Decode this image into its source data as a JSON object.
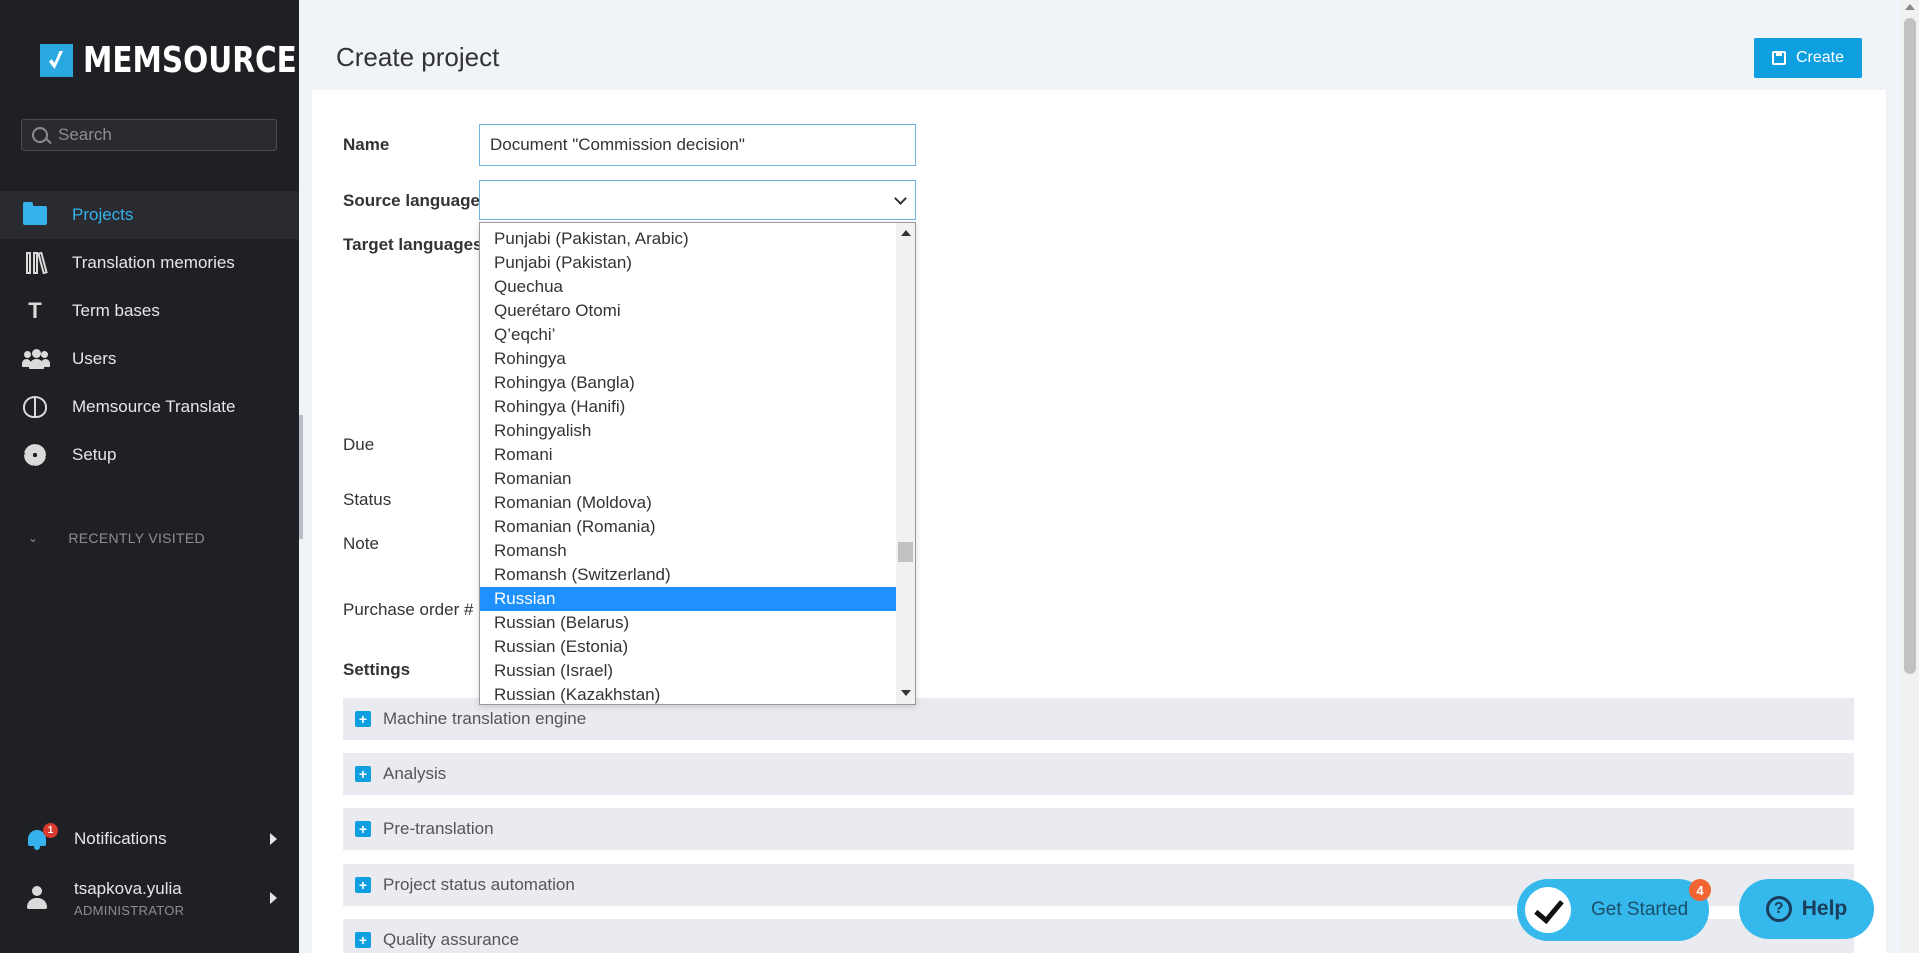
{
  "app": {
    "brand": "MEMSOURCE"
  },
  "sidebar": {
    "search_placeholder": "Search",
    "items": [
      {
        "label": "Projects",
        "icon": "folder-icon",
        "active": true
      },
      {
        "label": "Translation memories",
        "icon": "books-icon",
        "active": false
      },
      {
        "label": "Term bases",
        "icon": "text-icon",
        "active": false
      },
      {
        "label": "Users",
        "icon": "users-icon",
        "active": false
      },
      {
        "label": "Memsource Translate",
        "icon": "brain-icon",
        "active": false
      },
      {
        "label": "Setup",
        "icon": "gear-icon",
        "active": false
      }
    ],
    "term_bases_glyph": "T",
    "recently_visited": "RECENTLY VISITED",
    "notifications": {
      "label": "Notifications",
      "count": "1"
    },
    "user": {
      "name": "tsapkova.yulia",
      "role": "ADMINISTRATOR"
    }
  },
  "header": {
    "title": "Create project",
    "create_label": "Create"
  },
  "form": {
    "name_label": "Name",
    "name_value": "Document \"Commission decision\"",
    "source_label": "Source language",
    "source_value": "",
    "target_label": "Target languages",
    "due_label": "Due",
    "status_label": "Status",
    "note_label": "Note",
    "po_label": "Purchase order #"
  },
  "dropdown": {
    "options": [
      "Punjabi (Pakistan, Arabic)",
      "Punjabi (Pakistan)",
      "Quechua",
      "Querétaro Otomi",
      "Q’eqchi’",
      "Rohingya",
      "Rohingya (Bangla)",
      "Rohingya (Hanifi)",
      "Rohingyalish",
      "Romani",
      "Romanian",
      "Romanian (Moldova)",
      "Romanian (Romania)",
      "Romansh",
      "Romansh (Switzerland)",
      "Russian",
      "Russian (Belarus)",
      "Russian (Estonia)",
      "Russian (Israel)",
      "Russian (Kazakhstan)"
    ],
    "highlighted": "Russian"
  },
  "settings": {
    "title": "Settings",
    "sections": [
      "Machine translation engine",
      "Analysis",
      "Pre-translation",
      "Project status automation",
      "Quality assurance"
    ]
  },
  "widgets": {
    "get_started": {
      "label": "Get Started",
      "count": "4"
    },
    "help_label": "Help"
  },
  "colors": {
    "accent": "#0d9fe0",
    "sidebar_bg": "#1f2024",
    "selected_option": "#1e90ff"
  }
}
